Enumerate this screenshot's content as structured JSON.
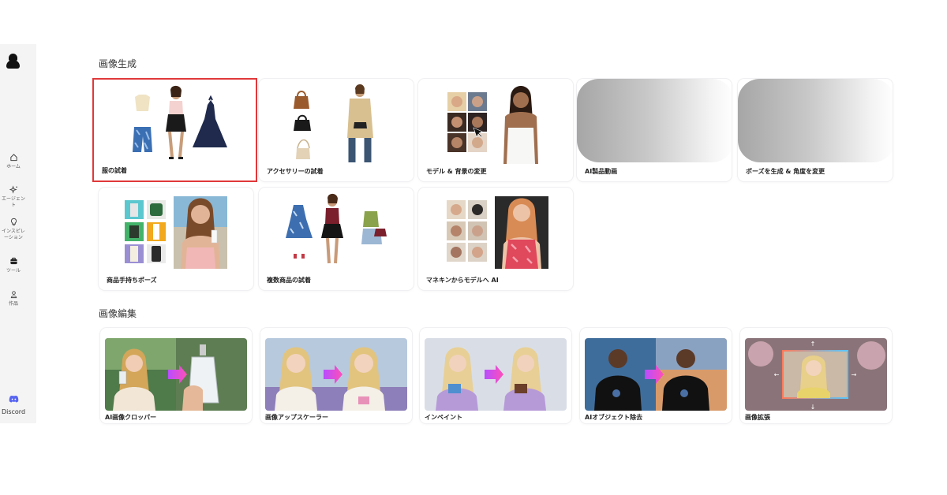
{
  "sidebar": {
    "items": [
      {
        "label": "ホーム",
        "icon": "home-icon"
      },
      {
        "label": "エージェント",
        "icon": "sparkle-icon"
      },
      {
        "label": "インスピレーション",
        "icon": "lightbulb-icon"
      },
      {
        "label": "ツール",
        "icon": "toolbox-icon"
      },
      {
        "label": "作品",
        "icon": "user-icon"
      }
    ],
    "discord": {
      "label": "Discord",
      "icon": "discord-icon"
    }
  },
  "sections": {
    "generation": {
      "title": "画像生成",
      "cards": [
        {
          "label": "服の試着",
          "selected": true
        },
        {
          "label": "アクセサリーの試着"
        },
        {
          "label": "モデル & 背景の変更"
        },
        {
          "label": "AI製品動画"
        },
        {
          "label": "ポーズを生成 & 角度を変更"
        },
        {
          "label": "商品手持ちポーズ"
        },
        {
          "label": "複数商品の試着"
        },
        {
          "label": "マネキンからモデルへ AI"
        }
      ]
    },
    "editing": {
      "title": "画像編集",
      "cards": [
        {
          "label": "AI画像クロッパー"
        },
        {
          "label": "画像アップスケーラー"
        },
        {
          "label": "インペイント"
        },
        {
          "label": "AIオブジェクト除去"
        },
        {
          "label": "画像拡張"
        }
      ]
    }
  },
  "colors": {
    "selected_border": "#e0383a",
    "arrow_gradient_start": "#b84dff",
    "arrow_gradient_end": "#ff4fb8"
  }
}
